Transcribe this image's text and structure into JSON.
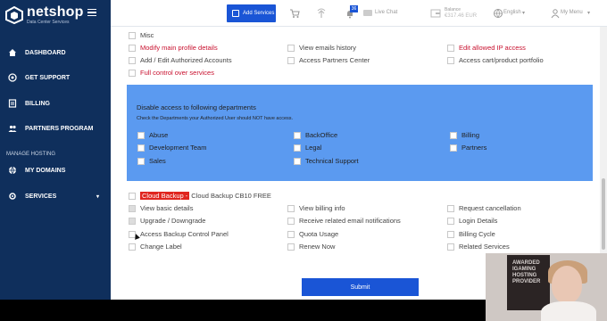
{
  "brand": {
    "name": "netshop",
    "tagline": "Data Center Services"
  },
  "sidebar": {
    "items": [
      {
        "label": "DASHBOARD",
        "icon": "home-icon"
      },
      {
        "label": "GET SUPPORT",
        "icon": "support-icon"
      },
      {
        "label": "BILLING",
        "icon": "billing-icon"
      },
      {
        "label": "PARTNERS PROGRAM",
        "icon": "partners-icon"
      }
    ],
    "manage_label": "MANAGE HOSTING",
    "hosting_items": [
      {
        "label": "MY DOMAINS",
        "icon": "globe-icon"
      },
      {
        "label": "SERVICES",
        "icon": "services-icon"
      }
    ]
  },
  "header": {
    "add_services": "Add Services",
    "notification_count": "36",
    "live_chat": "Live Chat",
    "balance_label": "Balance",
    "balance_value": "€317.46 EUR",
    "language": "English",
    "menu": "My Menu"
  },
  "permissions_top": {
    "col1": [
      "Misc",
      "Modify main profile details",
      "Add / Edit Authorized Accounts",
      "Full control over services"
    ],
    "col2": [
      "View emails history",
      "Access Partners Center"
    ],
    "col3": [
      "Edit allowed IP access",
      "Access cart/product portfolio"
    ]
  },
  "departments": {
    "title": "Disable access to following departments",
    "subtitle": "Check the Departments your Authorized User should NOT have access.",
    "col1": [
      "Abuse",
      "Development Team",
      "Sales"
    ],
    "col2": [
      "BackOffice",
      "Legal",
      "Technical Support"
    ],
    "col3": [
      "Billing",
      "Partners"
    ]
  },
  "cloud_backup": {
    "tag": "Cloud Backup",
    "separator": "-",
    "product": "Cloud Backup CB10 FREE",
    "col1": [
      "View basic details",
      "Upgrade / Downgrade",
      "Access Backup Control Panel",
      "Change Label"
    ],
    "col2": [
      "View billing info",
      "Receive related email notifications",
      "Quota Usage",
      "Renew Now"
    ],
    "col3": [
      "Request cancellation",
      "Login Details",
      "Billing Cycle",
      "Related Services"
    ]
  },
  "submit_label": "Submit",
  "webcam": {
    "screen_text": "AWARDED IGAMING HOSTING PROVIDER"
  },
  "colors": {
    "sidebar": "#0f2f5c",
    "accent": "#1a55d6",
    "panel": "#5b9af0",
    "danger": "#c8102e"
  }
}
